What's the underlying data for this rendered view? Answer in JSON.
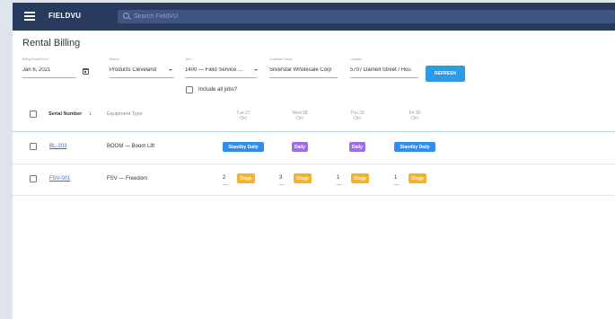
{
  "app": {
    "brand": "FIELDVU"
  },
  "search": {
    "placeholder": "Search FieldVU"
  },
  "page": {
    "title": "Rental Billing"
  },
  "filters": {
    "billing_period_end": {
      "label": "Billing Period End *",
      "value": "Jan 6, 2021"
    },
    "branch": {
      "label": "Branch",
      "value": "Products Cleveland"
    },
    "job": {
      "label": "Job *",
      "value": "1400 — Field Service ..."
    },
    "customer": {
      "label": "Customer Name",
      "value": "Silverstar Wholesale Corp"
    },
    "location": {
      "label": "Location",
      "value": "5707 Darnell Street / Hou"
    },
    "include_all_jobs": {
      "label": "Include all jobs?",
      "checked": false
    },
    "refresh_label": "REFRESH"
  },
  "table": {
    "columns": {
      "serial": "Serial Number",
      "sort_icon": "arrow-down-icon",
      "equipment": "Equipment Type"
    },
    "days": [
      {
        "weekday": "Tue 27",
        "month": "Oct"
      },
      {
        "weekday": "Wed 28",
        "month": "Oct"
      },
      {
        "weekday": "Thu 29",
        "month": "Oct"
      },
      {
        "weekday": "Fri 30",
        "month": "Oct"
      }
    ],
    "rows": [
      {
        "serial": "BL-203",
        "equipment": "BOOM — Boom Lift",
        "days": [
          {
            "qty": "",
            "status": "Standby Daily",
            "color": "#2f8df0"
          },
          {
            "qty": "",
            "status": "Daily",
            "color": "#9d6de8"
          },
          {
            "qty": "",
            "status": "Daily",
            "color": "#9d6de8"
          },
          {
            "qty": "",
            "status": "Standby Daily",
            "color": "#2f8df0"
          }
        ]
      },
      {
        "serial": "FSV-001",
        "equipment": "FSV — Freedom",
        "days": [
          {
            "qty": "2",
            "status": "Stage",
            "color": "#f7b22b"
          },
          {
            "qty": "3",
            "status": "Stage",
            "color": "#f7b22b"
          },
          {
            "qty": "1",
            "status": "Stage",
            "color": "#f7b22b"
          },
          {
            "qty": "1",
            "status": "Stage",
            "color": "#f7b22b"
          }
        ]
      }
    ]
  },
  "colors": {
    "topbar": "#283a5e",
    "accent": "#2e9ae6",
    "link": "#2e6fd1"
  }
}
